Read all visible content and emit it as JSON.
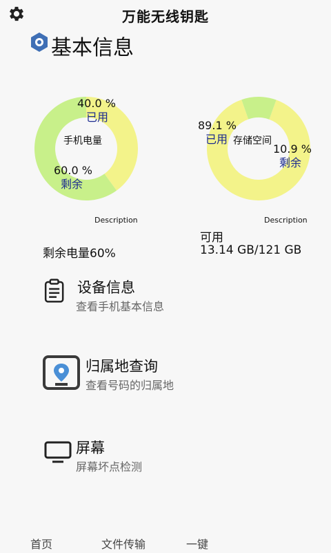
{
  "app": {
    "title": "万能无线钥匙"
  },
  "section": {
    "title": "基本信息"
  },
  "battery_chart": {
    "center_label": "手机电量",
    "used_percent": "40.0 %",
    "used_label": "已用",
    "remain_percent": "60.0 %",
    "remain_label": "剩余",
    "description": "Description",
    "summary": "剩余电量60%",
    "colors": {
      "used": "#f3f38a",
      "remain": "#c8f08a"
    }
  },
  "storage_chart": {
    "center_label": "存储空间",
    "used_percent": "89.1 %",
    "used_label": "已用",
    "remain_percent": "10.9 %",
    "remain_label": "剩余",
    "description": "Description",
    "summary_label": "可用",
    "summary_value": "13.14 GB/121 GB",
    "colors": {
      "used": "#f3f38a",
      "remain": "#c8f08a"
    }
  },
  "chart_data": [
    {
      "type": "pie",
      "categories": [
        "已用",
        "剩余"
      ],
      "values": [
        40.0,
        60.0
      ],
      "title": "手机电量"
    },
    {
      "type": "pie",
      "categories": [
        "已用",
        "剩余"
      ],
      "values": [
        89.1,
        10.9
      ],
      "title": "存储空间"
    }
  ],
  "menu": [
    {
      "title": "设备信息",
      "subtitle": "查看手机基本信息",
      "icon": "clipboard-icon"
    },
    {
      "title": "归属地查询",
      "subtitle": "查看号码的归属地",
      "icon": "location-pin-icon"
    },
    {
      "title": "屏幕",
      "subtitle": "屏幕坏点检测",
      "icon": "monitor-icon"
    }
  ],
  "tabs": [
    {
      "label": "首页"
    },
    {
      "label": "文件传输"
    },
    {
      "label": "一键"
    }
  ]
}
